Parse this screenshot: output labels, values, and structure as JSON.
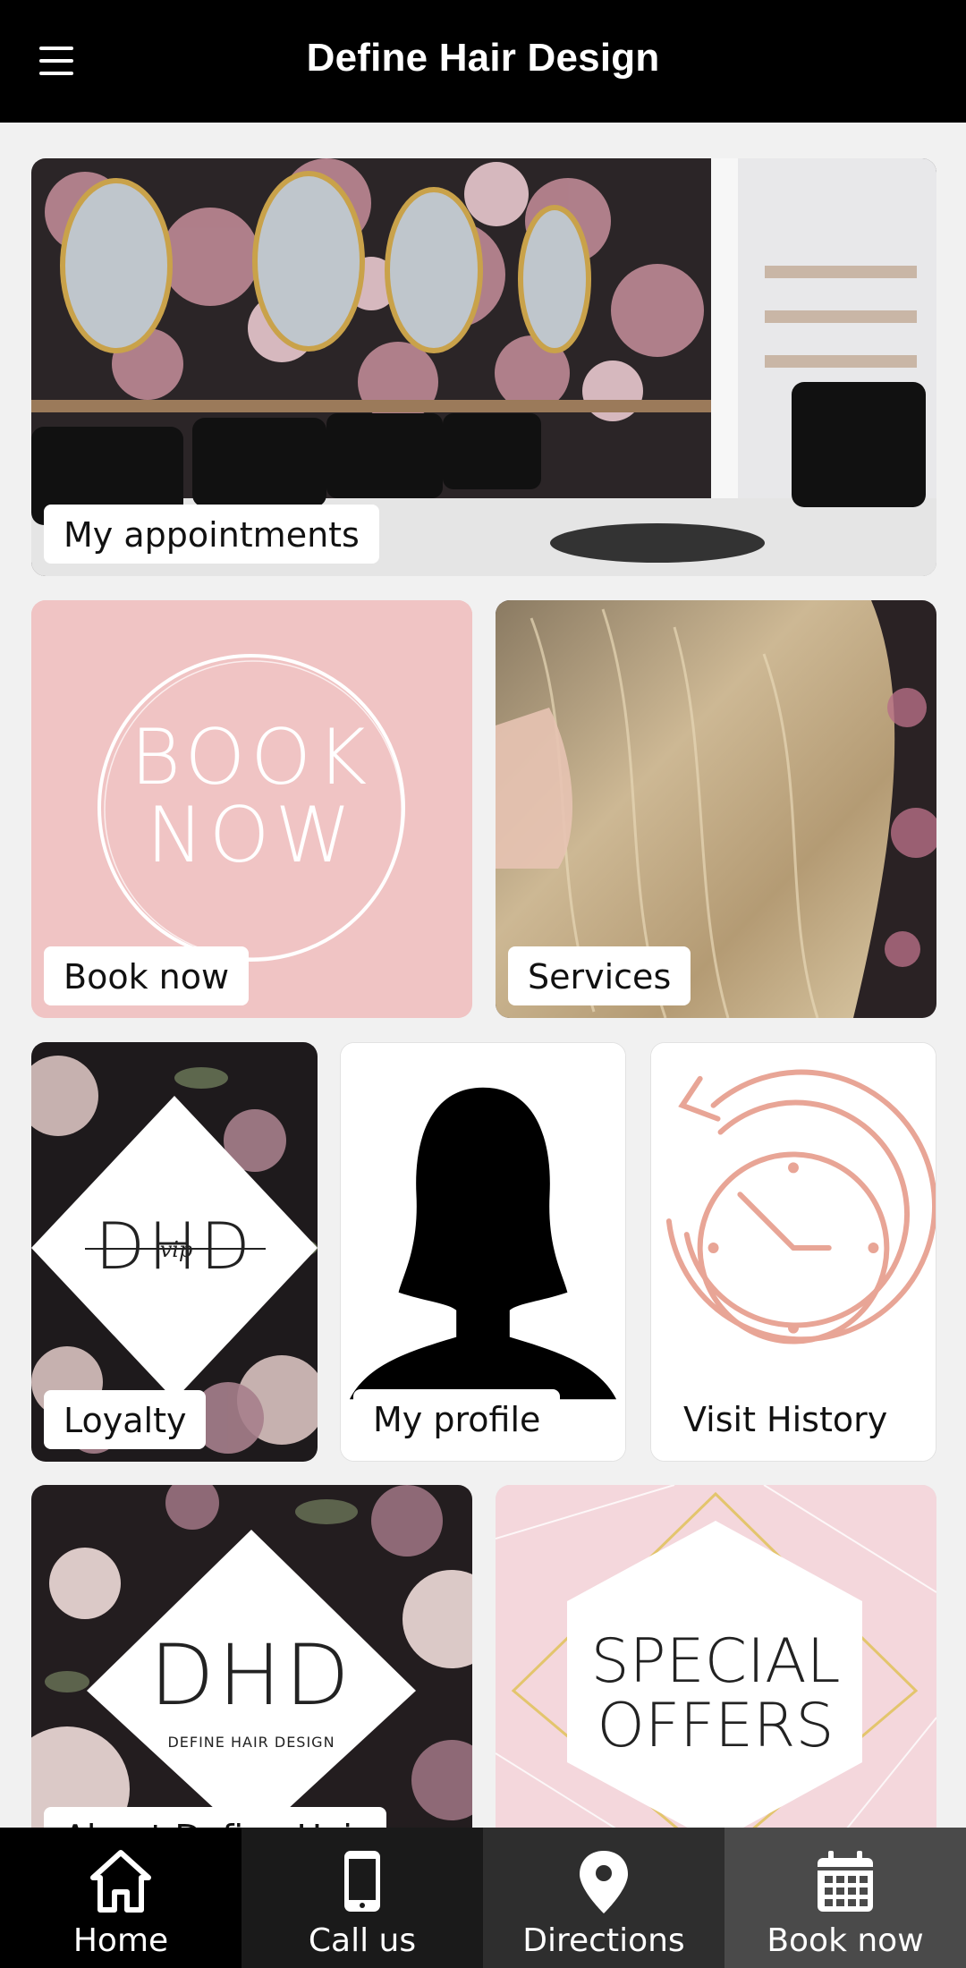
{
  "header": {
    "title": "Define Hair Design",
    "menu_icon": "hamburger-menu-icon"
  },
  "tiles": {
    "appointments": {
      "label": "My appointments"
    },
    "book_now": {
      "label": "Book now",
      "art_line1": "BOOK",
      "art_line2": "NOW"
    },
    "services": {
      "label": "Services"
    },
    "loyalty": {
      "label": "Loyalty",
      "logo_text": "DHD",
      "logo_sub": "vip"
    },
    "profile": {
      "label": "My profile"
    },
    "visit_history": {
      "label": "Visit History"
    },
    "about": {
      "label": "About Define Hair",
      "logo_text": "DHD",
      "logo_sub": "DEFINE HAIR DESIGN"
    },
    "special_offers": {
      "label": "",
      "art_line1": "SPECIAL",
      "art_line2": "OFFERS"
    }
  },
  "bottom_nav": [
    {
      "label": "Home",
      "icon": "home-icon",
      "bg": "#000000"
    },
    {
      "label": "Call us",
      "icon": "phone-icon",
      "bg": "#1a1a1a"
    },
    {
      "label": "Directions",
      "icon": "map-pin-icon",
      "bg": "#2e2e2e"
    },
    {
      "label": "Book now",
      "icon": "calendar-icon",
      "bg": "#4a4a4a"
    }
  ],
  "colors": {
    "header_bg": "#000000",
    "page_bg": "#f1f1f1",
    "pink": "#f0c4c4",
    "rose_gold": "#e8a596"
  }
}
